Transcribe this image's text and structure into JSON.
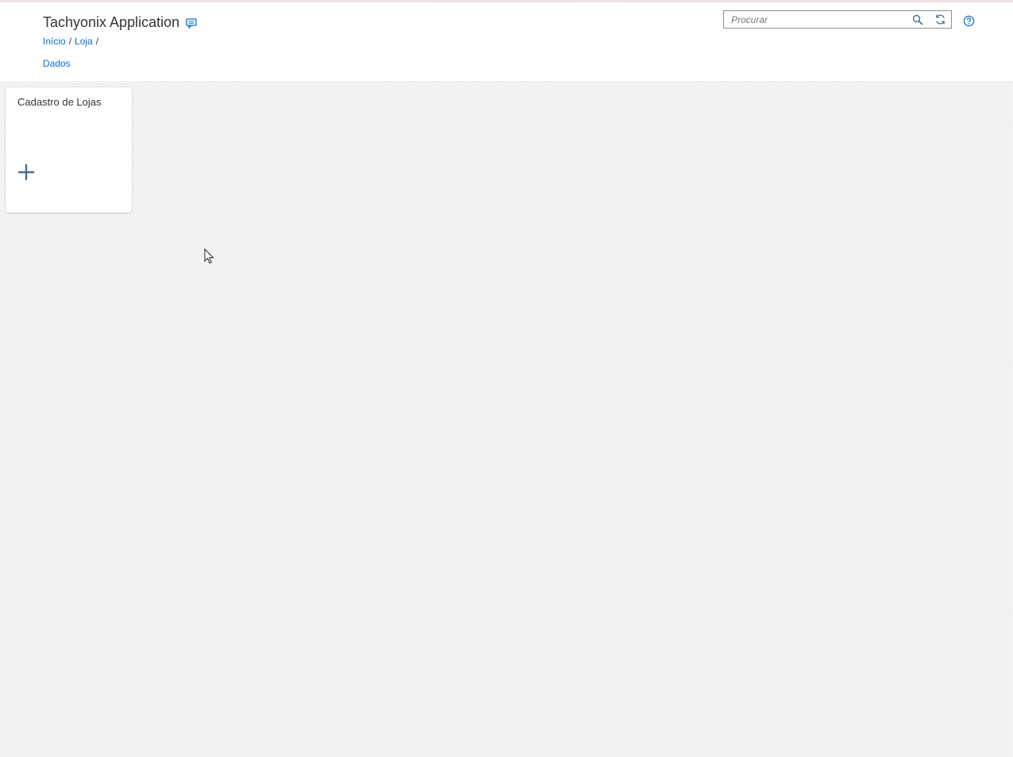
{
  "header": {
    "app_title": "Tachyonix Application",
    "feedback_icon": "feedback-icon",
    "breadcrumb": {
      "items": [
        "Início",
        "Loja"
      ],
      "separator": "/"
    },
    "sub_link": "Dados"
  },
  "search": {
    "placeholder": "Procurar",
    "value": "",
    "search_icon": "search-icon",
    "refresh_icon": "refresh-icon"
  },
  "help_icon": "help-icon",
  "tiles": [
    {
      "title": "Cadastro de Lojas",
      "icon": "plus-icon"
    }
  ],
  "colors": {
    "accent": "#0a6ed1",
    "icon": "#4a6b8e",
    "text": "#32363a",
    "background": "#f4f4f4"
  }
}
